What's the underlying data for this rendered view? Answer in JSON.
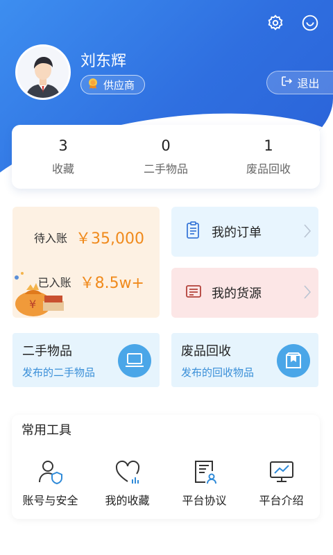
{
  "profile": {
    "name": "刘东辉",
    "role": "供应商",
    "logout_label": "退出"
  },
  "header_icons": [
    "settings-icon",
    "smile-icon"
  ],
  "stats": [
    {
      "value": "3",
      "label": "收藏"
    },
    {
      "value": "0",
      "label": "二手物品"
    },
    {
      "value": "1",
      "label": "废品回收"
    }
  ],
  "money": {
    "pending_label": "待入账",
    "pending_value": "￥35,000",
    "received_label": "已入账",
    "received_value": "￥8.5w+"
  },
  "nav": {
    "orders_label": "我的订单",
    "goods_label": "我的货源"
  },
  "features": [
    {
      "title": "二手物品",
      "subtitle": "发布的二手物品",
      "icon": "laptop-icon"
    },
    {
      "title": "废品回收",
      "subtitle": "发布的回收物品",
      "icon": "recycle-box-icon"
    }
  ],
  "tools": {
    "title": "常用工具",
    "items": [
      {
        "label": "账号与安全",
        "icon": "account-security-icon"
      },
      {
        "label": "我的收藏",
        "icon": "heart-chart-icon"
      },
      {
        "label": "平台协议",
        "icon": "document-user-icon"
      },
      {
        "label": "平台介绍",
        "icon": "monitor-chart-icon"
      }
    ]
  },
  "colors": {
    "primary": "#2f6fe0",
    "orange": "#f08a1c",
    "light_blue_card": "#e6f4fd",
    "orders_card": "#e8f5fe",
    "goods_card": "#fce6e6",
    "money_card": "#fdf1e3"
  }
}
